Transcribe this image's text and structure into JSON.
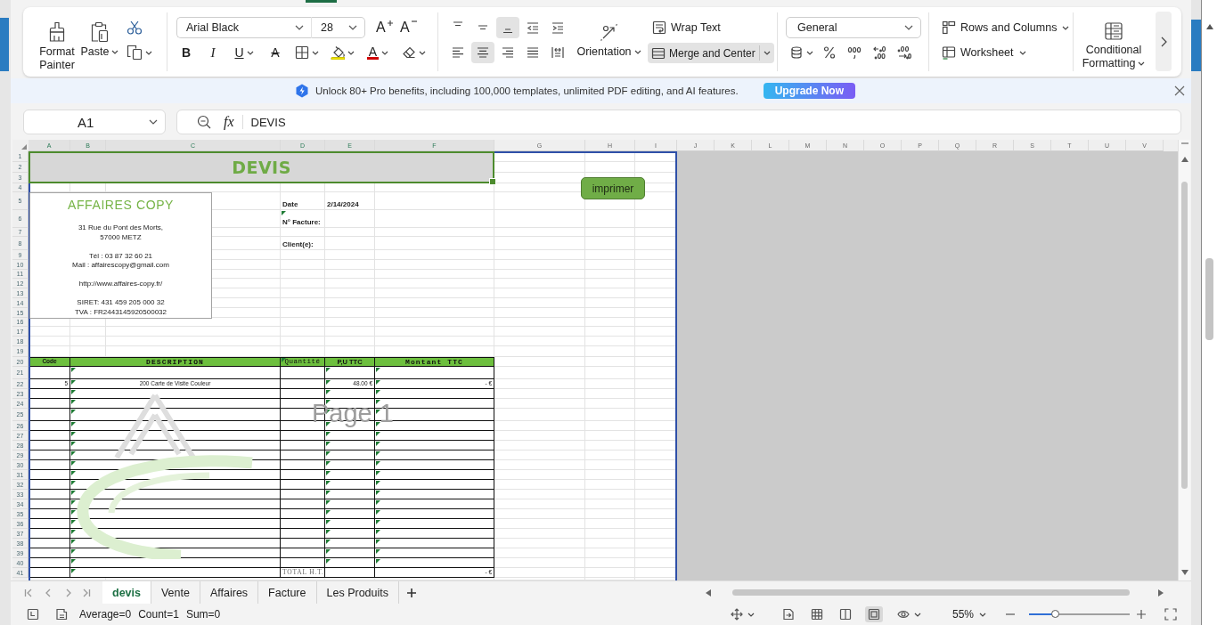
{
  "ribbon": {
    "tab_indicator": true,
    "format_painter": "Format Painter",
    "paste": "Paste",
    "font_name": "Arial Black",
    "font_size": "28",
    "size_buttons": [
      {
        "kind": "grow",
        "glyph": "A"
      },
      {
        "kind": "shrink",
        "glyph": "A"
      }
    ],
    "font_buttons": [
      {
        "kind": "bold",
        "glyph": "B"
      },
      {
        "kind": "italic",
        "glyph": "I"
      },
      {
        "kind": "underline",
        "glyph": "U"
      },
      {
        "kind": "strikethrough",
        "glyph": "A"
      },
      {
        "kind": "borders"
      },
      {
        "kind": "fill_color"
      },
      {
        "kind": "font_color",
        "glyph": "A"
      },
      {
        "kind": "clear"
      }
    ],
    "align_buttons": [
      {
        "kind": "top",
        "selected": false
      },
      {
        "kind": "middle",
        "selected": false
      },
      {
        "kind": "bottom",
        "selected": true
      },
      {
        "kind": "outdent",
        "selected": false
      },
      {
        "kind": "indent",
        "selected": false
      },
      {
        "kind": "left",
        "selected": false
      },
      {
        "kind": "center",
        "selected": true
      },
      {
        "kind": "right",
        "selected": false
      },
      {
        "kind": "justify",
        "selected": false
      },
      {
        "kind": "distributed",
        "selected": false
      }
    ],
    "orientation": "Orientation",
    "wrap_text": "Wrap Text",
    "merge_center": {
      "label": "Merge and Center",
      "selected": true
    },
    "number_format": "General",
    "number_buttons": [
      {
        "kind": "currency"
      },
      {
        "kind": "percent"
      },
      {
        "kind": "thousands"
      },
      {
        "kind": "add_decimal"
      },
      {
        "kind": "remove_decimal"
      }
    ],
    "rows_columns": "Rows and Columns",
    "worksheet": "Worksheet",
    "conditional_formatting": "Conditional Formatting"
  },
  "promo": {
    "text": "Unlock 80+ Pro benefits, including 100,000 templates, unlimited PDF editing, and AI features.",
    "button": "Upgrade Now"
  },
  "formula_bar": {
    "name_box": "A1",
    "function_label": "fx",
    "content": "DEVIS"
  },
  "sheet": {
    "column_headers": [
      {
        "label": "A",
        "selected": true
      },
      {
        "label": "B",
        "selected": true
      },
      {
        "label": "C",
        "selected": true
      },
      {
        "label": "D",
        "selected": true
      },
      {
        "label": "E",
        "selected": true
      },
      {
        "label": "F",
        "selected": true
      },
      {
        "label": "G",
        "selected": false
      },
      {
        "label": "H",
        "selected": false
      },
      {
        "label": "I",
        "selected": false
      },
      {
        "label": "J",
        "selected": false
      },
      {
        "label": "K",
        "selected": false
      },
      {
        "label": "L",
        "selected": false
      },
      {
        "label": "M",
        "selected": false
      },
      {
        "label": "N",
        "selected": false
      },
      {
        "label": "O",
        "selected": false
      },
      {
        "label": "P",
        "selected": false
      },
      {
        "label": "Q",
        "selected": false
      },
      {
        "label": "R",
        "selected": false
      },
      {
        "label": "S",
        "selected": false
      },
      {
        "label": "T",
        "selected": false
      },
      {
        "label": "U",
        "selected": false
      },
      {
        "label": "V",
        "selected": false
      }
    ],
    "row_headers": [
      "1",
      "2",
      "3",
      "4",
      "5",
      "6",
      "7",
      "8",
      "9",
      "10",
      "11",
      "12",
      "13",
      "14",
      "15",
      "16",
      "17",
      "18",
      "19",
      "20",
      "21",
      "22",
      "23",
      "24",
      "25",
      "26",
      "27",
      "28",
      "29",
      "30",
      "31",
      "32",
      "33",
      "34",
      "35",
      "36",
      "37",
      "38",
      "39",
      "40",
      "41"
    ],
    "title": {
      "text": "DEVIS",
      "selected": true
    },
    "company": {
      "name": "AFFAIRES COPY",
      "blocks": [
        [
          "31 Rue du Pont des Morts,",
          "57000 METZ"
        ],
        [
          "Tél : 03 87 32 60 21",
          "Mail : affairescopy@gmail.com"
        ],
        [
          "http://www.affaires-copy.fr/"
        ],
        [
          "SIRET: 431 459 205 000 32",
          "TVA : FR2443145920500032"
        ]
      ]
    },
    "fields": [
      {
        "label": "Date",
        "value": "2/14/2024",
        "flagged": false
      },
      {
        "label": "N° Facture:",
        "flagged": true
      },
      {
        "label": "Client(e):",
        "flagged": false
      }
    ],
    "print_button": "imprimer",
    "table": {
      "columns": [
        {
          "label": "Code",
          "flagged": false
        },
        {
          "label": "DESCRIPTION",
          "flagged": false
        },
        {
          "label": "Quantité",
          "flagged": true
        },
        {
          "label": "P,U TTC",
          "flagged": false
        },
        {
          "label": "Montant TTC",
          "flagged": false
        }
      ],
      "rows": [
        {
          "kind": "item",
          "flagged": [
            false,
            true,
            false,
            true,
            true
          ]
        },
        {
          "kind": "item",
          "code": "5",
          "description": "200 Carte de Visite Couleur",
          "unit_price": "48.00 €",
          "amount": "- €",
          "flagged": [
            false,
            true,
            false,
            true,
            true
          ]
        },
        {
          "kind": "item",
          "flagged": [
            false,
            true,
            false,
            true,
            true
          ]
        },
        {
          "kind": "item",
          "flagged": [
            false,
            true,
            false,
            true,
            true
          ]
        },
        {
          "kind": "item",
          "flagged": [
            false,
            true,
            false,
            true,
            true
          ]
        },
        {
          "kind": "item",
          "flagged": [
            false,
            true,
            false,
            true,
            true
          ]
        },
        {
          "kind": "item",
          "flagged": [
            false,
            true,
            false,
            true,
            true
          ]
        },
        {
          "kind": "item",
          "flagged": [
            false,
            true,
            false,
            true,
            true
          ]
        },
        {
          "kind": "item",
          "flagged": [
            false,
            true,
            false,
            true,
            true
          ]
        },
        {
          "kind": "item",
          "flagged": [
            false,
            true,
            false,
            true,
            true
          ]
        },
        {
          "kind": "item",
          "flagged": [
            false,
            true,
            false,
            true,
            true
          ]
        },
        {
          "kind": "item",
          "flagged": [
            false,
            true,
            false,
            true,
            true
          ]
        },
        {
          "kind": "item",
          "flagged": [
            false,
            true,
            false,
            true,
            true
          ]
        },
        {
          "kind": "item",
          "flagged": [
            false,
            true,
            false,
            true,
            true
          ]
        },
        {
          "kind": "item",
          "flagged": [
            false,
            true,
            false,
            true,
            true
          ]
        },
        {
          "kind": "item",
          "flagged": [
            false,
            true,
            false,
            true,
            true
          ]
        },
        {
          "kind": "item",
          "flagged": [
            false,
            true,
            false,
            true,
            true
          ]
        },
        {
          "kind": "item",
          "flagged": [
            false,
            true,
            false,
            true,
            true
          ]
        },
        {
          "kind": "item",
          "flagged": [
            false,
            true,
            false,
            true,
            true
          ]
        },
        {
          "kind": "item",
          "flagged": [
            false,
            true,
            false,
            true,
            true
          ]
        },
        {
          "kind": "total",
          "label": "TOTAL H.T.",
          "amount": "- €",
          "flagged": [
            false,
            true,
            false,
            false,
            false
          ]
        }
      ]
    },
    "page_label": "Page 1"
  },
  "sheet_tabs": [
    {
      "label": "devis",
      "selected": true
    },
    {
      "label": "Vente",
      "selected": false
    },
    {
      "label": "Affaires",
      "selected": false
    },
    {
      "label": "Facture",
      "selected": false
    },
    {
      "label": "Les Produits",
      "selected": false
    }
  ],
  "status_bar": {
    "summary": [
      "Average=0",
      "Count=1",
      "Sum=0"
    ],
    "view_modes": [
      {
        "kind": "normal",
        "selected": false
      },
      {
        "kind": "page_layout",
        "selected": false
      },
      {
        "kind": "page_break",
        "selected": true
      }
    ],
    "zoom": "55%",
    "zoom_slider": {
      "level": 0.26
    }
  }
}
